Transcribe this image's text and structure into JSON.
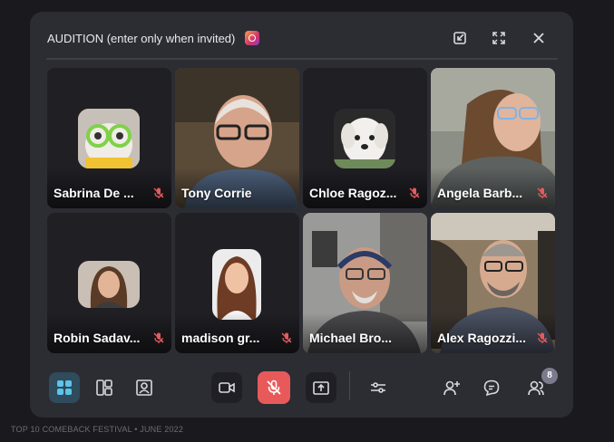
{
  "window": {
    "title": "AUDITION (enter only when invited)"
  },
  "participants": [
    {
      "name": "Sabrina De ...",
      "muted": true
    },
    {
      "name": "Tony Corrie",
      "muted": false
    },
    {
      "name": "Chloe Ragoz...",
      "muted": true
    },
    {
      "name": "Angela Barb...",
      "muted": true
    },
    {
      "name": "Robin Sadav...",
      "muted": true
    },
    {
      "name": "madison gr...",
      "muted": true
    },
    {
      "name": "Michael Bro...",
      "muted": false
    },
    {
      "name": "Alex Ragozzi...",
      "muted": true
    }
  ],
  "toolbar": {
    "participant_count": "8"
  },
  "footer": {
    "text": "TOP 10 COMEBACK FESTIVAL • JUNE 2022"
  },
  "colors": {
    "accent_active": "#2f4b5c",
    "mute_red": "#e85a5a",
    "window_bg": "#2c2c33"
  }
}
